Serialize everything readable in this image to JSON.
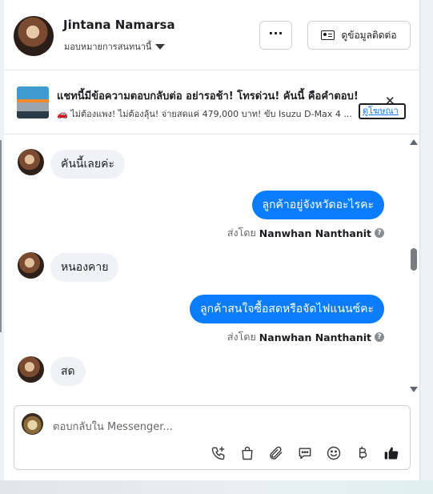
{
  "header": {
    "name": "Jintana Namarsa",
    "assign_label": "มอบหมายการสนทนานี้",
    "more_label": "···",
    "contact_label": "ดูข้อมูลติดต่อ"
  },
  "ad": {
    "title": "แชทนี้มีข้อความตอบกลับต่อ อย่ารอช้า! โทรด่วน! คันนี้ คือคำตอบ!",
    "car_emoji": "🚗",
    "text": " ไม่ต้องแพง! ไม่ต้องลุ้น! จ่ายสดแค่ 479,000 บาท! ขับ Isuzu D-Max 4 ...",
    "link_label": "ดูโฆษณา",
    "close_label": "✕"
  },
  "messages": [
    {
      "direction": "in",
      "text": "คันนี้เลยค่ะ"
    },
    {
      "direction": "out",
      "text": "ลูกค้าอยู่จังหวัดอะไรคะ",
      "sent_prefix": "ส่งโดย",
      "sender": "Nanwhan Nanthanit"
    },
    {
      "direction": "in",
      "text": "หนองคาย"
    },
    {
      "direction": "out",
      "text": "ลูกค้าสนใจซื้อสดหรือจัดไฟแนนซ์คะ",
      "sent_prefix": "ส่งโดย",
      "sender": "Nanwhan Nanthanit"
    },
    {
      "direction": "in",
      "text": "สด"
    }
  ],
  "composer": {
    "placeholder": "ตอบกลับใน Messenger...",
    "tools": [
      "phone-plus-icon",
      "shopping-bag-icon",
      "paperclip-icon",
      "chat-bubble-icon",
      "emoji-icon",
      "baht-icon",
      "thumbs-up-icon"
    ]
  },
  "colors": {
    "outgoing_bubble": "#0a7cff",
    "incoming_bubble": "#f0f2f5",
    "link": "#1877f2"
  }
}
